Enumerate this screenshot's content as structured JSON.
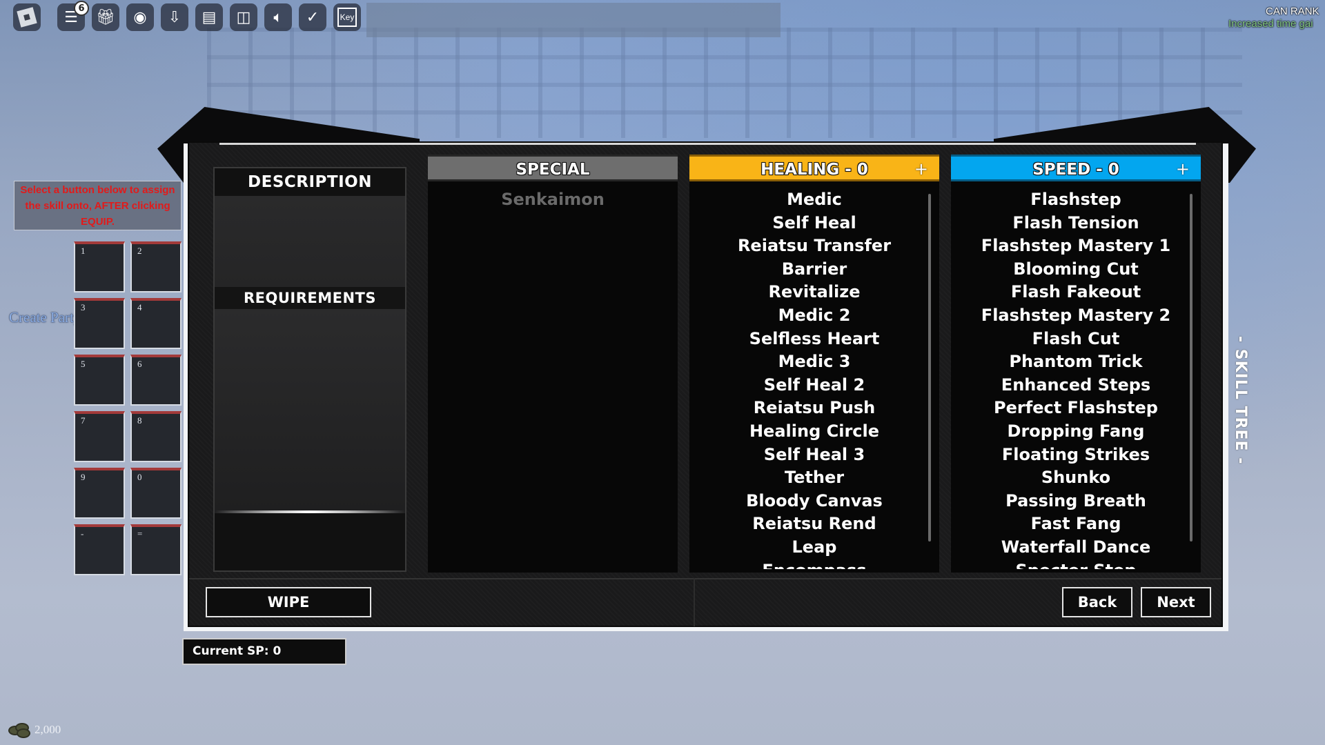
{
  "toolbar": {
    "buttons": [
      {
        "name": "roblox-menu",
        "icon": "roblox-logo-icon"
      },
      {
        "name": "chat",
        "icon": "chat-icon",
        "badge": "6"
      },
      {
        "name": "gift",
        "icon": "gift-icon"
      },
      {
        "name": "screenshot",
        "icon": "camera-icon"
      },
      {
        "name": "download",
        "icon": "download-icon"
      },
      {
        "name": "server",
        "icon": "server-icon"
      },
      {
        "name": "exit",
        "icon": "door-icon"
      },
      {
        "name": "sound",
        "icon": "speaker-icon"
      },
      {
        "name": "run",
        "icon": "runner-icon"
      },
      {
        "name": "key",
        "icon": "key-icon",
        "label": "Key"
      }
    ]
  },
  "rank": {
    "title": "CAN RANK",
    "subtitle": "Increased time gai"
  },
  "hint": {
    "text": "Select a button below to assign the skill onto, AFTER clicking EQUIP."
  },
  "create_party": "Create Party",
  "slots": [
    "1",
    "2",
    "3",
    "4",
    "5",
    "6",
    "7",
    "8",
    "9",
    "0",
    "-",
    "="
  ],
  "panel": {
    "description_title": "DESCRIPTION",
    "requirements_title": "REQUIREMENTS",
    "columns": {
      "special": {
        "title": "SPECIAL",
        "color": "#6e6e6e",
        "skills": [
          "Senkaimon"
        ]
      },
      "healing": {
        "title": "HEALING - 0",
        "color": "#f9b417",
        "plus": "+",
        "skills": [
          "Medic",
          "Self Heal",
          "Reiatsu Transfer",
          "Barrier",
          "Revitalize",
          "Medic 2",
          "Selfless Heart",
          "Medic 3",
          "Self Heal 2",
          "Reiatsu Push",
          "Healing Circle",
          "Self Heal 3",
          "Tether",
          "Bloody Canvas",
          "Reiatsu Rend",
          "Leap",
          "Encompass"
        ]
      },
      "speed": {
        "title": "SPEED - 0",
        "color": "#03a6ef",
        "plus": "+",
        "skills": [
          "Flashstep",
          "Flash Tension",
          "Flashstep Mastery 1",
          "Blooming Cut",
          "Flash Fakeout",
          "Flashstep Mastery 2",
          "Flash Cut",
          "Phantom Trick",
          "Enhanced Steps",
          "Perfect Flashstep",
          "Dropping Fang",
          "Floating Strikes",
          "Shunko",
          "Passing Breath",
          "Fast Fang",
          "Waterfall Dance",
          "Specter Step"
        ]
      }
    },
    "wipe_label": "WIPE",
    "back_label": "Back",
    "next_label": "Next",
    "side_label": "- SKILL TREE -"
  },
  "current_sp": "Current SP: 0",
  "currency": "2,000"
}
